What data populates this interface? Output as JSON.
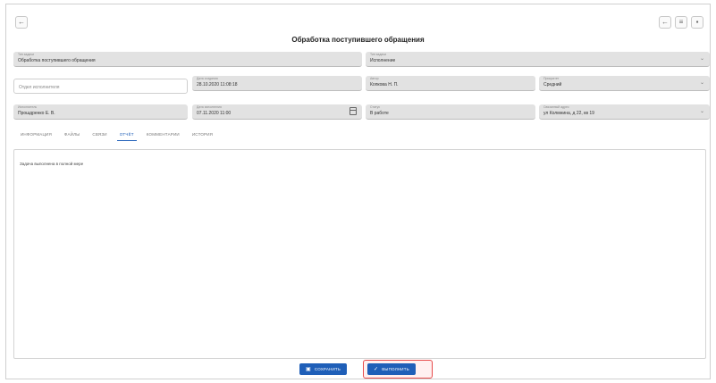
{
  "toolbar": {
    "back_icon": "arrow-left-icon",
    "back_glyph": "←",
    "right_buttons": [
      {
        "icon": "back-arrow-icon",
        "glyph": "←"
      },
      {
        "icon": "list-icon",
        "glyph": "≡"
      },
      {
        "icon": "print-icon",
        "glyph": "▪"
      }
    ]
  },
  "title": "Обработка поступившего обращения",
  "fields": {
    "task_name": {
      "label": "Тип задачи",
      "value": "Обработка поступившего обращения"
    },
    "task_type": {
      "label": "Тип задачи",
      "value": "Исполнение"
    },
    "department": {
      "placeholder": "Отдел исполнителя"
    },
    "created": {
      "label": "Дата создания",
      "value": "28.10.2020 11:08:18"
    },
    "author": {
      "label": "Автор",
      "value": "Копкова Н. П."
    },
    "priority": {
      "label": "Приоритет",
      "value": "Средний"
    },
    "executor": {
      "label": "Исполнитель",
      "value": "Прошдренко Е. В."
    },
    "due_date": {
      "label": "Дата исполнения",
      "value": "07.11.2020 11:00"
    },
    "status": {
      "label": "Статус",
      "value": "В работе"
    },
    "address": {
      "label": "Связанный адрес",
      "value": "ул Колмнина, д 22, кв 19"
    }
  },
  "tabs": [
    "ИНФОРМАЦИЯ",
    "ФАЙЛЫ",
    "СВЯЗИ",
    "ОТЧЁТ",
    "КОММЕНТАРИИ",
    "ИСТОРИЯ"
  ],
  "active_tab": "ОТЧЁТ",
  "report": {
    "text": "Задача выполнена в полной мере"
  },
  "buttons": {
    "save": {
      "label": "СОХРАНИТЬ",
      "icon": "save-icon"
    },
    "complete": {
      "label": "ВЫПОЛНИТЬ",
      "icon": "check-icon"
    }
  },
  "colors": {
    "primary": "#1f5fb8",
    "highlight": "#e74a4a"
  }
}
